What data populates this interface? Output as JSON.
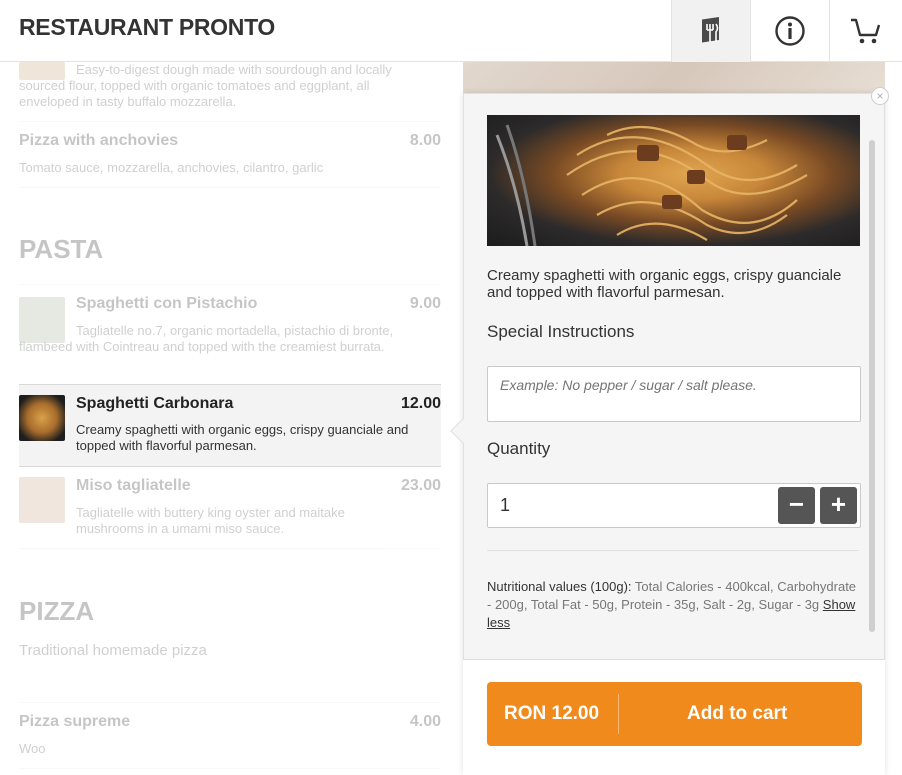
{
  "header": {
    "title": "RESTAURANT PRONTO",
    "buttons": [
      "menu-icon",
      "info-icon",
      "cart-icon"
    ]
  },
  "menu": {
    "top_item_desc": "Easy-to-digest dough made with sourdough and locally sourced flour, topped with organic tomatoes and eggplant, all enveloped in tasty buffalo mozzarella.",
    "anchovies": {
      "name": "Pizza with anchovies",
      "price": "8.00",
      "desc": "Tomato sauce, mozzarella, anchovies, cilantro, garlic"
    },
    "pasta_title": "PASTA",
    "pistachio": {
      "name": "Spaghetti con Pistachio",
      "price": "9.00",
      "desc": "Tagliatelle no.7, organic mortadella, pistachio di bronte, flambeed with Cointreau and topped with the creamiest burrata."
    },
    "carbonara": {
      "name": "Spaghetti Carbonara",
      "price": "12.00",
      "desc": "Creamy spaghetti with organic eggs, crispy guanciale and topped with flavorful parmesan."
    },
    "miso": {
      "name": "Miso tagliatelle",
      "price": "23.00",
      "desc": "Tagliatelle with buttery king oyster and maitake mushrooms in a umami miso sauce."
    },
    "pizza_title": "PIZZA",
    "pizza_sub": "Traditional homemade pizza",
    "supreme": {
      "name": "Pizza supreme",
      "price": "4.00",
      "desc": "Woo"
    }
  },
  "detail": {
    "description": "Creamy spaghetti with organic eggs, crispy guanciale and topped with flavorful parmesan.",
    "special_label": "Special Instructions",
    "special_placeholder": "Example: No pepper / sugar / salt please.",
    "quantity_label": "Quantity",
    "quantity_value": "1",
    "minus": "−",
    "plus": "+",
    "nutrition_label": "Nutritional values (100g):",
    "nutrition_text": "Total Calories - 400kcal, Carbohydrate - 200g, Total Fat - 50g, Protein - 35g, Salt - 2g, Sugar - 3g",
    "show_less": "Show less",
    "close": "×",
    "cart_price": "RON 12.00",
    "cart_label": "Add to cart"
  },
  "colors": {
    "accent": "#f08a1c",
    "qty_button": "#555555"
  }
}
